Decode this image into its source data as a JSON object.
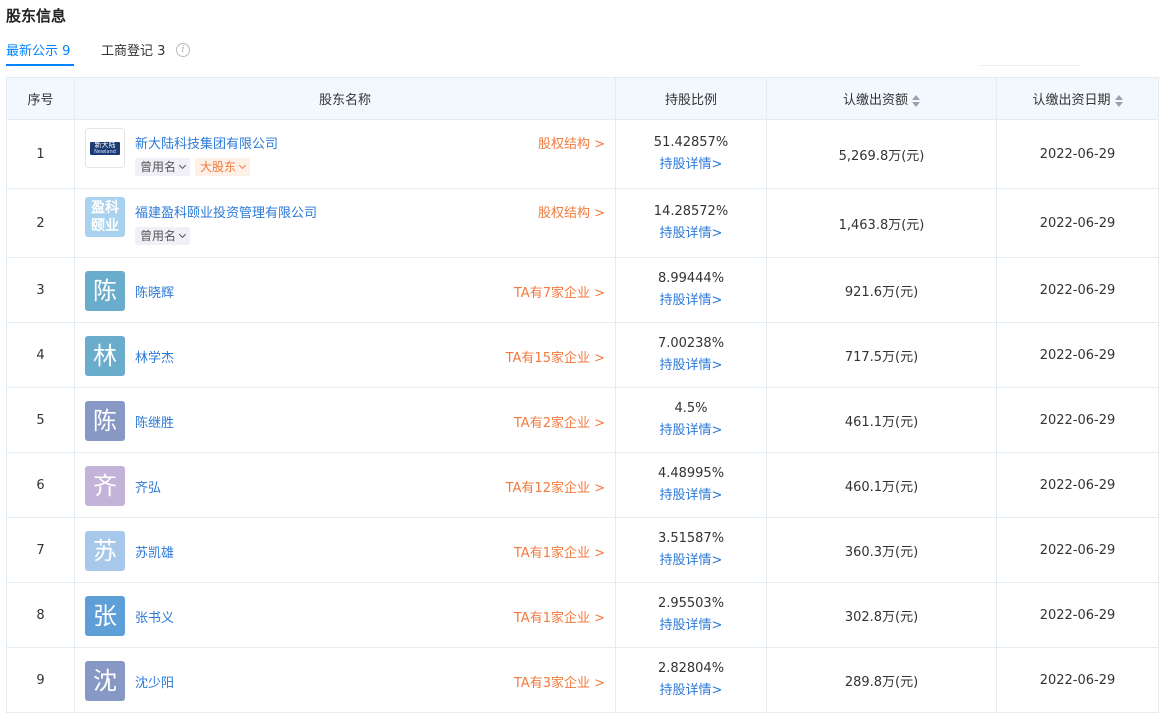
{
  "section_title": "股东信息",
  "tabs": [
    {
      "label": "最新公示 9",
      "active": true
    },
    {
      "label": "工商登记 3",
      "active": false
    }
  ],
  "columns": {
    "index": "序号",
    "name": "股东名称",
    "ratio": "持股比例",
    "amount": "认缴出资额",
    "date": "认缴出资日期"
  },
  "colors": {
    "accent": "#0084ff",
    "link": "#2b79d8",
    "orange": "#f27a3e",
    "header_bg": "#f2f8fe"
  },
  "rows": [
    {
      "index": "1",
      "name": "新大陆科技集团有限公司",
      "avatar_kind": "logo",
      "logo_text": "新大陆",
      "logo_sub": "Newland",
      "link": "股权结构 >",
      "tags": [
        "曾用名",
        "大股东"
      ],
      "ratio": "51.42857%",
      "detail": "持股详情>",
      "amount": "5,269.8万(元)",
      "date": "2022-06-29"
    },
    {
      "index": "2",
      "name": "福建盈科颐业投资管理有限公司",
      "avatar_kind": "text2",
      "avatar_text": "盈科颐业",
      "avatar_color": "#a9d2ee",
      "link": "股权结构 >",
      "tags": [
        "曾用名"
      ],
      "ratio": "14.28572%",
      "detail": "持股详情>",
      "amount": "1,463.8万(元)",
      "date": "2022-06-29"
    },
    {
      "index": "3",
      "name": "陈晓辉",
      "avatar_kind": "char",
      "avatar_text": "陈",
      "avatar_color": "#6aaccc",
      "link": "TA有7家企业 >",
      "tags": [],
      "ratio": "8.99444%",
      "detail": "持股详情>",
      "amount": "921.6万(元)",
      "date": "2022-06-29"
    },
    {
      "index": "4",
      "name": "林学杰",
      "avatar_kind": "char",
      "avatar_text": "林",
      "avatar_color": "#6aaccc",
      "link": "TA有15家企业 >",
      "tags": [],
      "ratio": "7.00238%",
      "detail": "持股详情>",
      "amount": "717.5万(元)",
      "date": "2022-06-29"
    },
    {
      "index": "5",
      "name": "陈继胜",
      "avatar_kind": "char",
      "avatar_text": "陈",
      "avatar_color": "#8898c4",
      "link": "TA有2家企业 >",
      "tags": [],
      "ratio": "4.5%",
      "detail": "持股详情>",
      "amount": "461.1万(元)",
      "date": "2022-06-29"
    },
    {
      "index": "6",
      "name": "齐弘",
      "avatar_kind": "char",
      "avatar_text": "齐",
      "avatar_color": "#c3b3d8",
      "link": "TA有12家企业 >",
      "tags": [],
      "ratio": "4.48995%",
      "detail": "持股详情>",
      "amount": "460.1万(元)",
      "date": "2022-06-29"
    },
    {
      "index": "7",
      "name": "苏凯雄",
      "avatar_kind": "char",
      "avatar_text": "苏",
      "avatar_color": "#a7c8ea",
      "link": "TA有1家企业 >",
      "tags": [],
      "ratio": "3.51587%",
      "detail": "持股详情>",
      "amount": "360.3万(元)",
      "date": "2022-06-29"
    },
    {
      "index": "8",
      "name": "张书义",
      "avatar_kind": "char",
      "avatar_text": "张",
      "avatar_color": "#5d9fd6",
      "link": "TA有1家企业 >",
      "tags": [],
      "ratio": "2.95503%",
      "detail": "持股详情>",
      "amount": "302.8万(元)",
      "date": "2022-06-29"
    },
    {
      "index": "9",
      "name": "沈少阳",
      "avatar_kind": "char",
      "avatar_text": "沈",
      "avatar_color": "#8898c4",
      "link": "TA有3家企业 >",
      "tags": [],
      "ratio": "2.82804%",
      "detail": "持股详情>",
      "amount": "289.8万(元)",
      "date": "2022-06-29"
    }
  ]
}
